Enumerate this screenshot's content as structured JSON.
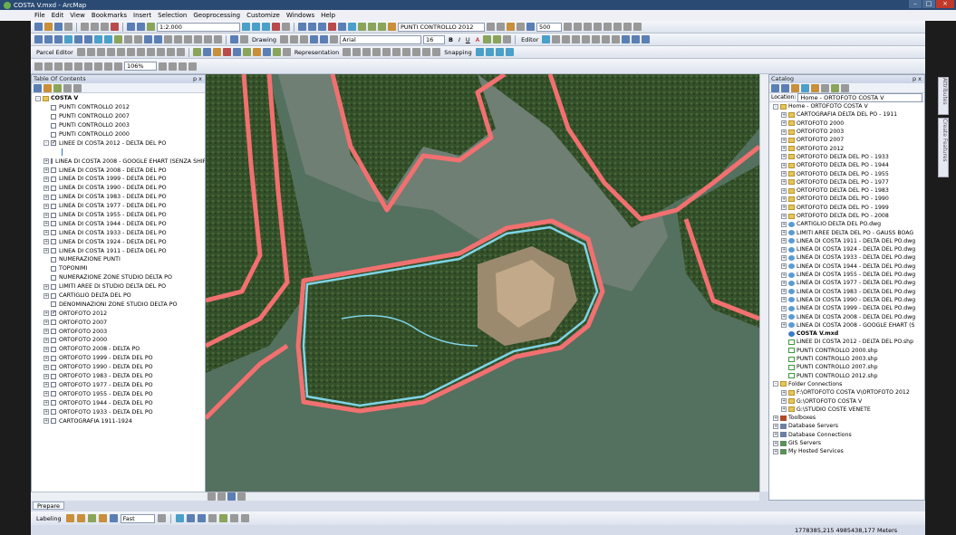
{
  "titlebar": {
    "title": "COSTA V.mxd - ArcMap"
  },
  "menu": [
    "File",
    "Edit",
    "View",
    "Bookmarks",
    "Insert",
    "Selection",
    "Geoprocessing",
    "Customize",
    "Windows",
    "Help"
  ],
  "toolbar": {
    "scale": "1:2.000",
    "layer_combo": "PUNTI CONTROLLO 2012",
    "zoom_value": "500",
    "drawing_label": "Drawing",
    "font_name": "Arial",
    "font_size": "16",
    "bold": "B",
    "italic": "I",
    "underline": "U",
    "font_color_label": "A",
    "editor_label": "Editor",
    "parcel_editor_label": "Parcel Editor",
    "zoom_percent": "106%",
    "representation_label": "Representation",
    "snapping_label": "Snapping"
  },
  "toc": {
    "title": "Table Of Contents",
    "pin": "p x",
    "items": [
      {
        "label": "COSTA V",
        "level": 0,
        "exp": "-",
        "kind": "frame"
      },
      {
        "label": "PUNTI CONTROLLO 2012",
        "level": 1,
        "exp": "",
        "checked": false
      },
      {
        "label": "PUNTI CONTROLLO 2007",
        "level": 1,
        "exp": "",
        "checked": false
      },
      {
        "label": "PUNTI CONTROLLO 2003",
        "level": 1,
        "exp": "",
        "checked": false
      },
      {
        "label": "PUNTI CONTROLLO 2000",
        "level": 1,
        "exp": "",
        "checked": false
      },
      {
        "label": "LINEE DI COSTA 2012 - DELTA DEL PO",
        "level": 1,
        "exp": "-",
        "checked": true
      },
      {
        "label": "",
        "level": 2,
        "kind": "symbol"
      },
      {
        "label": "LINEA DI COSTA 2008 - GOOGLE EHART (SENZA SHIFT",
        "level": 1,
        "exp": "+",
        "checked": false
      },
      {
        "label": "LINEA DI COSTA 2008 - DELTA DEL PO",
        "level": 1,
        "exp": "+",
        "checked": false
      },
      {
        "label": "LINEA DI COSTA 1999 - DELTA DEL PO",
        "level": 1,
        "exp": "+",
        "checked": false
      },
      {
        "label": "LINEA DI COSTA 1990 - DELTA DEL PO",
        "level": 1,
        "exp": "+",
        "checked": false
      },
      {
        "label": "LINEA DI COSTA 1983 - DELTA DEL PO",
        "level": 1,
        "exp": "+",
        "checked": false
      },
      {
        "label": "LINEA DI COSTA 1977 - DELTA DEL PO",
        "level": 1,
        "exp": "+",
        "checked": false
      },
      {
        "label": "LINEA DI COSTA 1955 - DELTA DEL PO",
        "level": 1,
        "exp": "+",
        "checked": false
      },
      {
        "label": "LINEA DI COSTA 1944 - DELTA DEL PO",
        "level": 1,
        "exp": "+",
        "checked": false
      },
      {
        "label": "LINEA DI COSTA 1933 - DELTA DEL PO",
        "level": 1,
        "exp": "+",
        "checked": false
      },
      {
        "label": "LINEA DI COSTA 1924 - DELTA DEL PO",
        "level": 1,
        "exp": "+",
        "checked": false
      },
      {
        "label": "LINEA DI COSTA 1911 - DELTA DEL PO",
        "level": 1,
        "exp": "+",
        "checked": false
      },
      {
        "label": "NUMERAZIONE PUNTI",
        "level": 1,
        "exp": "",
        "checked": false
      },
      {
        "label": "TOPONIMI",
        "level": 1,
        "exp": "",
        "checked": false
      },
      {
        "label": "NUMERAZIONE ZONE STUDIO DELTA PO",
        "level": 1,
        "exp": "",
        "checked": false
      },
      {
        "label": "LIMITI AREE DI STUDIO DELTA DEL PO",
        "level": 1,
        "exp": "+",
        "checked": false
      },
      {
        "label": "CARTIGLIO DELTA DEL PO",
        "level": 1,
        "exp": "+",
        "checked": false
      },
      {
        "label": "DENOMINAZIONI ZONE STUDIO DELTA PO",
        "level": 1,
        "exp": "",
        "checked": false
      },
      {
        "label": "ORTOFOTO 2012",
        "level": 1,
        "exp": "+",
        "checked": true
      },
      {
        "label": "ORTOFOTO 2007",
        "level": 1,
        "exp": "+",
        "checked": false
      },
      {
        "label": "ORTOFOTO 2003",
        "level": 1,
        "exp": "+",
        "checked": false
      },
      {
        "label": "ORTOFOTO 2000",
        "level": 1,
        "exp": "+",
        "checked": false
      },
      {
        "label": "ORTOFOTO 2008 - DELTA PO",
        "level": 1,
        "exp": "+",
        "checked": false
      },
      {
        "label": "ORTOFOTO 1999 - DELTA DEL PO",
        "level": 1,
        "exp": "+",
        "checked": false
      },
      {
        "label": "ORTOFOTO 1990 - DELTA DEL PO",
        "level": 1,
        "exp": "+",
        "checked": false
      },
      {
        "label": "ORTOFOTO 1983 - DELTA DEL PO",
        "level": 1,
        "exp": "+",
        "checked": false
      },
      {
        "label": "ORTOFOTO 1977 - DELTA DEL PO",
        "level": 1,
        "exp": "+",
        "checked": false
      },
      {
        "label": "ORTOFOTO 1955 - DELTA DEL PO",
        "level": 1,
        "exp": "+",
        "checked": false
      },
      {
        "label": "ORTOFOTO 1944 - DELTA DEL PO",
        "level": 1,
        "exp": "+",
        "checked": false
      },
      {
        "label": "ORTOFOTO 1933 - DELTA DEL PO",
        "level": 1,
        "exp": "+",
        "checked": false
      },
      {
        "label": "CARTOGRAFIA 1911-1924",
        "level": 1,
        "exp": "+",
        "checked": false
      }
    ]
  },
  "catalog": {
    "title": "Catalog",
    "location_label": "Location:",
    "location_value": "Home - ORTOFOTO COSTA V",
    "items": [
      {
        "label": "Home - ORTOFOTO COSTA V",
        "level": 0,
        "exp": "-",
        "icon": "folder"
      },
      {
        "label": "CARTOGRAFIA DELTA DEL PO - 1911",
        "level": 1,
        "exp": "+",
        "icon": "folder"
      },
      {
        "label": "ORTOFOTO 2000",
        "level": 1,
        "exp": "+",
        "icon": "folder"
      },
      {
        "label": "ORTOFOTO 2003",
        "level": 1,
        "exp": "+",
        "icon": "folder"
      },
      {
        "label": "ORTOFOTO 2007",
        "level": 1,
        "exp": "+",
        "icon": "folder"
      },
      {
        "label": "ORTOFOTO 2012",
        "level": 1,
        "exp": "+",
        "icon": "folder"
      },
      {
        "label": "ORTOFOTO DELTA DEL PO - 1933",
        "level": 1,
        "exp": "+",
        "icon": "folder"
      },
      {
        "label": "ORTOFOTO DELTA DEL PO - 1944",
        "level": 1,
        "exp": "+",
        "icon": "folder"
      },
      {
        "label": "ORTOFOTO DELTA DEL PO - 1955",
        "level": 1,
        "exp": "+",
        "icon": "folder"
      },
      {
        "label": "ORTOFOTO DELTA DEL PO - 1977",
        "level": 1,
        "exp": "+",
        "icon": "folder"
      },
      {
        "label": "ORTOFOTO DELTA DEL PO - 1983",
        "level": 1,
        "exp": "+",
        "icon": "folder"
      },
      {
        "label": "ORTOFOTO DELTA DEL PO - 1990",
        "level": 1,
        "exp": "+",
        "icon": "folder"
      },
      {
        "label": "ORTOFOTO DELTA DEL PO - 1999",
        "level": 1,
        "exp": "+",
        "icon": "folder"
      },
      {
        "label": "ORTOFOTO DELTA DEL PO - 2008",
        "level": 1,
        "exp": "+",
        "icon": "folder"
      },
      {
        "label": "CARTIGLIO DELTA DEL PO.dwg",
        "level": 1,
        "exp": "+",
        "icon": "cad"
      },
      {
        "label": "LIMITI AREE DELTA DEL PO - GAUSS BOAG",
        "level": 1,
        "exp": "+",
        "icon": "cad"
      },
      {
        "label": "LINEA DI COSTA 1911 - DELTA DEL PO.dwg",
        "level": 1,
        "exp": "+",
        "icon": "cad"
      },
      {
        "label": "LINEA DI COSTA 1924 - DELTA DEL PO.dwg",
        "level": 1,
        "exp": "+",
        "icon": "cad"
      },
      {
        "label": "LINEA DI COSTA 1933 - DELTA DEL PO.dwg",
        "level": 1,
        "exp": "+",
        "icon": "cad"
      },
      {
        "label": "LINEA DI COSTA 1944 - DELTA DEL PO.dwg",
        "level": 1,
        "exp": "+",
        "icon": "cad"
      },
      {
        "label": "LINEA DI COSTA 1955 - DELTA DEL PO.dwg",
        "level": 1,
        "exp": "+",
        "icon": "cad"
      },
      {
        "label": "LINEA DI COSTA 1977 - DELTA DEL PO.dwg",
        "level": 1,
        "exp": "+",
        "icon": "cad"
      },
      {
        "label": "LINEA DI COSTA 1983 - DELTA DEL PO.dwg",
        "level": 1,
        "exp": "+",
        "icon": "cad"
      },
      {
        "label": "LINEA DI COSTA 1990 - DELTA DEL PO.dwg",
        "level": 1,
        "exp": "+",
        "icon": "cad"
      },
      {
        "label": "LINEA DI COSTA 1999 - DELTA DEL PO.dwg",
        "level": 1,
        "exp": "+",
        "icon": "cad"
      },
      {
        "label": "LINEA DI COSTA 2008 - DELTA DEL PO.dwg",
        "level": 1,
        "exp": "+",
        "icon": "cad"
      },
      {
        "label": "LINEA DI COSTA 2008 - GOOGLE EHART (S",
        "level": 1,
        "exp": "+",
        "icon": "cad"
      },
      {
        "label": "COSTA V.mxd",
        "level": 1,
        "exp": "",
        "icon": "mxd",
        "bold": true
      },
      {
        "label": "LINEE DI COSTA 2012 - DELTA DEL PO.shp",
        "level": 1,
        "exp": "",
        "icon": "shp"
      },
      {
        "label": "PUNTI CONTROLLO 2000.shp",
        "level": 1,
        "exp": "",
        "icon": "shp"
      },
      {
        "label": "PUNTI CONTROLLO 2003.shp",
        "level": 1,
        "exp": "",
        "icon": "shp"
      },
      {
        "label": "PUNTI CONTROLLO 2007.shp",
        "level": 1,
        "exp": "",
        "icon": "shp"
      },
      {
        "label": "PUNTI CONTROLLO 2012.shp",
        "level": 1,
        "exp": "",
        "icon": "shp"
      },
      {
        "label": "Folder Connections",
        "level": 0,
        "exp": "-",
        "icon": "folder"
      },
      {
        "label": "F:\\ORTOFOTO COSTA V\\ORTOFOTO 2012",
        "level": 1,
        "exp": "+",
        "icon": "folder"
      },
      {
        "label": "G:\\ORTOFOTO COSTA V",
        "level": 1,
        "exp": "+",
        "icon": "folder"
      },
      {
        "label": "G:\\STUDIO COSTE VENETE",
        "level": 1,
        "exp": "+",
        "icon": "folder"
      },
      {
        "label": "Toolboxes",
        "level": 0,
        "exp": "+",
        "icon": "tool"
      },
      {
        "label": "Database Servers",
        "level": 0,
        "exp": "+",
        "icon": "db"
      },
      {
        "label": "Database Connections",
        "level": 0,
        "exp": "+",
        "icon": "db"
      },
      {
        "label": "GIS Servers",
        "level": 0,
        "exp": "+",
        "icon": "gis"
      },
      {
        "label": "My Hosted Services",
        "level": 0,
        "exp": "+",
        "icon": "gis"
      }
    ]
  },
  "side_tabs": [
    "Attributes",
    "Create Features"
  ],
  "bottom": {
    "prepare_tab": "Prepare",
    "labeling_label": "Labeling",
    "label_combo": "Fast",
    "coordinates": "1778385,215  4985438,177 Meters"
  },
  "colors": {
    "coastline_red": "#f26a6a",
    "coastline_cyan": "#7fd4e6",
    "water": "#4f6a5a"
  }
}
